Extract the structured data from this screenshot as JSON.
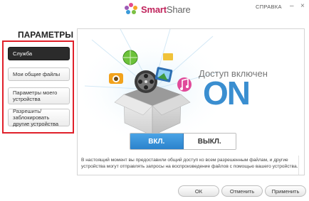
{
  "app": {
    "logo_word_1": "Smart",
    "logo_word_2": "Share",
    "help_label": "СПРАВКА",
    "minimize_glyph": "–",
    "close_glyph": "×"
  },
  "sidebar": {
    "title": "ПАРАМЕТРЫ",
    "items": [
      {
        "label": "Служба",
        "active": true
      },
      {
        "label": "Мои общие файлы",
        "active": false
      },
      {
        "label": "Параметры моего устройства",
        "active": false
      },
      {
        "label": "Разрешить/заблокировать другие устройства",
        "active": false
      }
    ]
  },
  "main": {
    "status_label": "Доступ включен",
    "status_value": "ON",
    "toggle": {
      "on_label": "ВКЛ.",
      "off_label": "ВЫКЛ.",
      "selected": "on"
    },
    "info_text": "В настоящий момент вы предоставили общий доступ ко всем разрешенным файлам, и другие устройства могут отправлять запросы на воспроизведение файлов с помощью вашего устройства."
  },
  "buttons": {
    "ok": "ОК",
    "cancel": "Отменить",
    "apply": "Применить"
  },
  "colors": {
    "accent_blue": "#2b82cc",
    "on_text_blue": "#3a8ed0",
    "highlight_red": "#e0202a",
    "active_item": "#2b2b2b"
  },
  "icons": [
    "photo-icon",
    "film-reel-icon",
    "music-note-icon",
    "globe-icon",
    "media-box-icon"
  ]
}
